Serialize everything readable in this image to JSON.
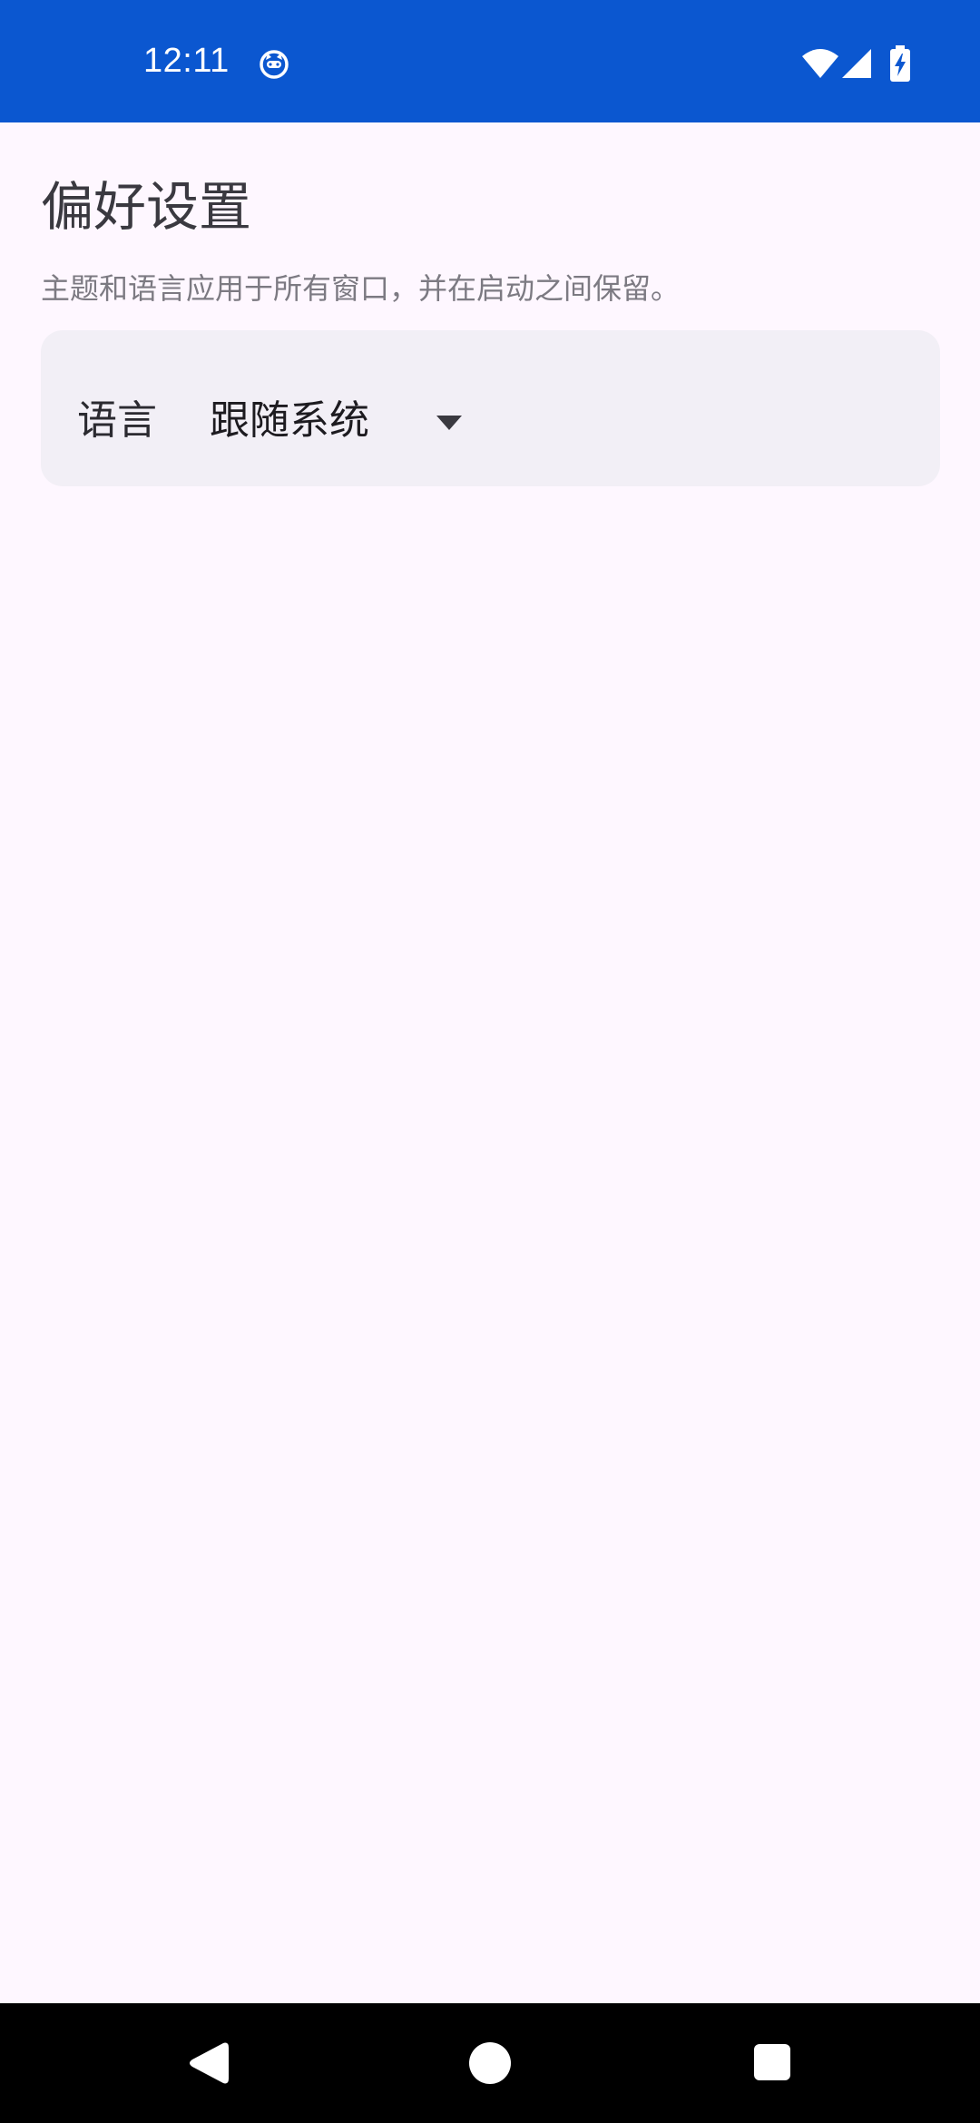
{
  "status_bar": {
    "time": "12:11",
    "background_color": "#0B57D0",
    "icons": [
      "app-notification-icon",
      "wifi-icon",
      "cell-signal-icon",
      "battery-charging-icon"
    ]
  },
  "page": {
    "title": "偏好设置",
    "subtitle": "主题和语言应用于所有窗口，并在启动之间保留。"
  },
  "language_setting": {
    "label": "语言",
    "selected_value": "跟随系统",
    "dropdown_icon": "dropdown-arrow-icon"
  },
  "nav_bar": {
    "icons": [
      "back-icon",
      "home-icon",
      "recents-icon"
    ]
  },
  "colors": {
    "background": "#FEF7FF",
    "card": "#F2EFF6",
    "accent": "#0B57D0"
  }
}
